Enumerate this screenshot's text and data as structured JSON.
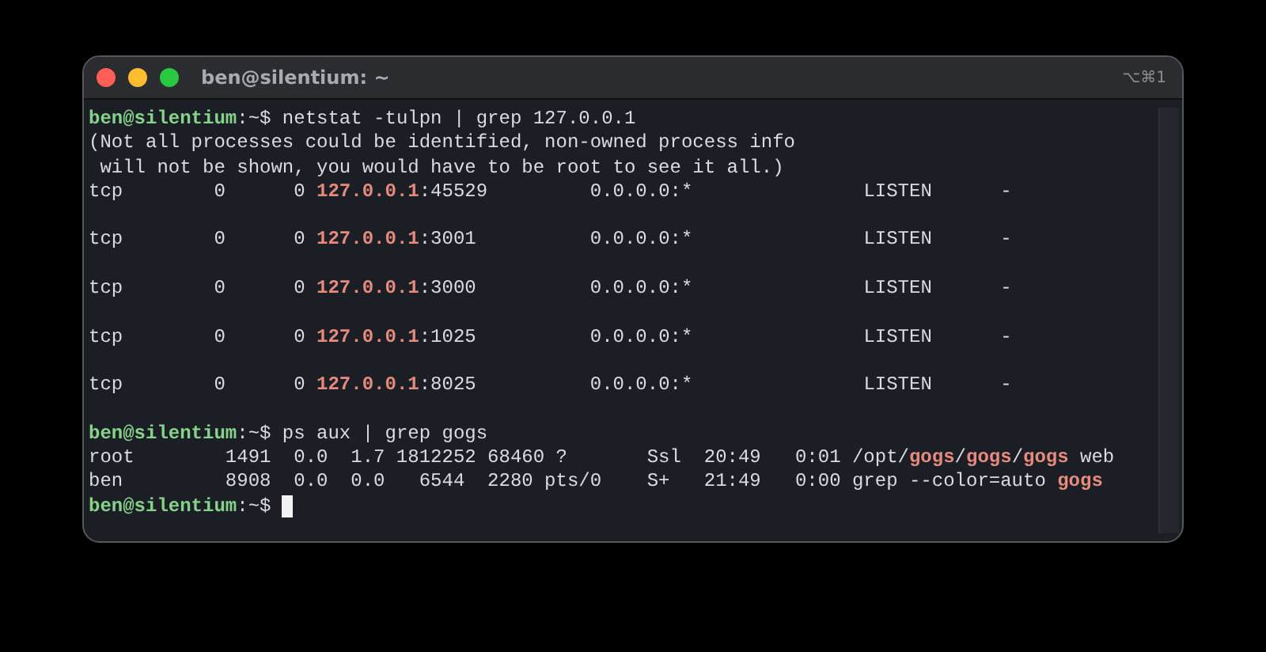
{
  "window": {
    "title": "ben@silentium: ~",
    "shortcut": "⌥⌘1"
  },
  "terminal": {
    "lines": [
      {
        "kind": "text",
        "segments": [
          {
            "kind": "prompt",
            "text": "ben@silentium"
          },
          {
            "kind": "plain",
            "text": ":~$ netstat -tulpn | grep 127.0.0.1"
          }
        ]
      },
      {
        "kind": "text",
        "segments": [
          {
            "kind": "plain",
            "text": "(Not all processes could be identified, non-owned process info"
          }
        ]
      },
      {
        "kind": "text",
        "segments": [
          {
            "kind": "plain",
            "text": " will not be shown, you would have to be root to see it all.)"
          }
        ]
      },
      {
        "kind": "text",
        "segments": [
          {
            "kind": "plain",
            "text": "tcp        0      0 "
          },
          {
            "kind": "match",
            "text": "127.0.0.1"
          },
          {
            "kind": "plain",
            "text": ":45529         0.0.0.0:*               LISTEN      -"
          }
        ]
      },
      {
        "kind": "blank"
      },
      {
        "kind": "text",
        "segments": [
          {
            "kind": "plain",
            "text": "tcp        0      0 "
          },
          {
            "kind": "match",
            "text": "127.0.0.1"
          },
          {
            "kind": "plain",
            "text": ":3001          0.0.0.0:*               LISTEN      -"
          }
        ]
      },
      {
        "kind": "blank"
      },
      {
        "kind": "text",
        "segments": [
          {
            "kind": "plain",
            "text": "tcp        0      0 "
          },
          {
            "kind": "match",
            "text": "127.0.0.1"
          },
          {
            "kind": "plain",
            "text": ":3000          0.0.0.0:*               LISTEN      -"
          }
        ]
      },
      {
        "kind": "blank"
      },
      {
        "kind": "text",
        "segments": [
          {
            "kind": "plain",
            "text": "tcp        0      0 "
          },
          {
            "kind": "match",
            "text": "127.0.0.1"
          },
          {
            "kind": "plain",
            "text": ":1025          0.0.0.0:*               LISTEN      -"
          }
        ]
      },
      {
        "kind": "blank"
      },
      {
        "kind": "text",
        "segments": [
          {
            "kind": "plain",
            "text": "tcp        0      0 "
          },
          {
            "kind": "match",
            "text": "127.0.0.1"
          },
          {
            "kind": "plain",
            "text": ":8025          0.0.0.0:*               LISTEN      -"
          }
        ]
      },
      {
        "kind": "blank"
      },
      {
        "kind": "text",
        "segments": [
          {
            "kind": "prompt",
            "text": "ben@silentium"
          },
          {
            "kind": "plain",
            "text": ":~$ ps aux | grep gogs"
          }
        ]
      },
      {
        "kind": "text",
        "segments": [
          {
            "kind": "plain",
            "text": "root        1491  0.0  1.7 1812252 68460 ?       Ssl  20:49   0:01 /opt/"
          },
          {
            "kind": "match",
            "text": "gogs"
          },
          {
            "kind": "plain",
            "text": "/"
          },
          {
            "kind": "match",
            "text": "gogs"
          },
          {
            "kind": "plain",
            "text": "/"
          },
          {
            "kind": "match",
            "text": "gogs"
          },
          {
            "kind": "plain",
            "text": " web"
          }
        ]
      },
      {
        "kind": "text",
        "segments": [
          {
            "kind": "plain",
            "text": "ben         8908  0.0  0.0   6544  2280 pts/0    S+   21:49   0:00 grep --color=auto "
          },
          {
            "kind": "match",
            "text": "gogs"
          }
        ]
      },
      {
        "kind": "text",
        "segments": [
          {
            "kind": "prompt",
            "text": "ben@silentium"
          },
          {
            "kind": "plain",
            "text": ":~$ "
          }
        ],
        "cursor": true
      }
    ]
  }
}
